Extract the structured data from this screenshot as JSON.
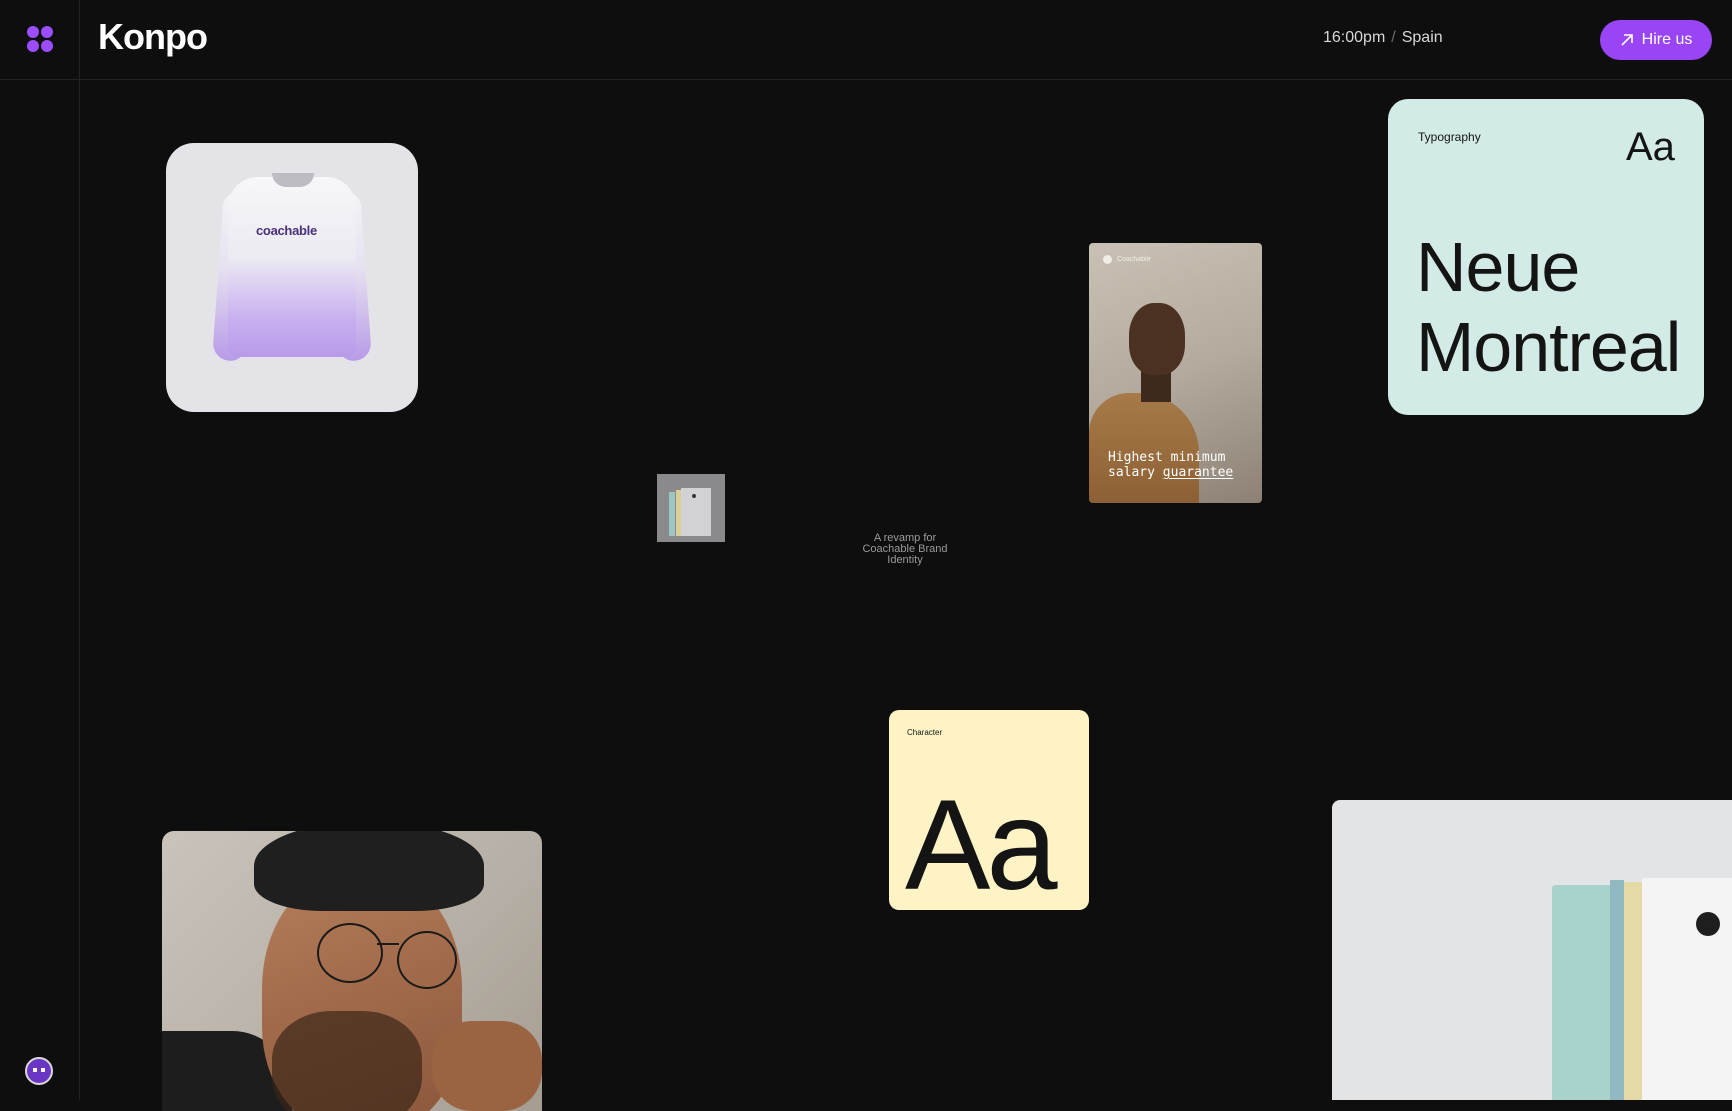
{
  "header": {
    "brand": "Konpo",
    "time": "16:00pm",
    "separator": "/",
    "location": "Spain",
    "cta_label": "Hire us"
  },
  "gallery": {
    "sweatshirt_logo": "coachable",
    "caption": "A revamp for Coachable Brand Identity",
    "poster": {
      "brand": "Coachable",
      "headline_line1": "Highest minimum",
      "headline_line2_plain": "salary ",
      "headline_line2_underlined": "guarantee"
    },
    "typography_card": {
      "label": "Typography",
      "sample": "Aa",
      "font_name_line1": "Neue",
      "font_name_line2": "Montreal"
    },
    "character_card": {
      "label": "Character",
      "sample": "Aa"
    }
  },
  "colors": {
    "background": "#0e0e0e",
    "accent": "#9a45f5",
    "typography_card": "#d3ebe6",
    "character_card": "#fef3c5"
  },
  "icons": [
    "grid-dots-icon",
    "arrow-up-right-icon",
    "avatar-icon"
  ]
}
